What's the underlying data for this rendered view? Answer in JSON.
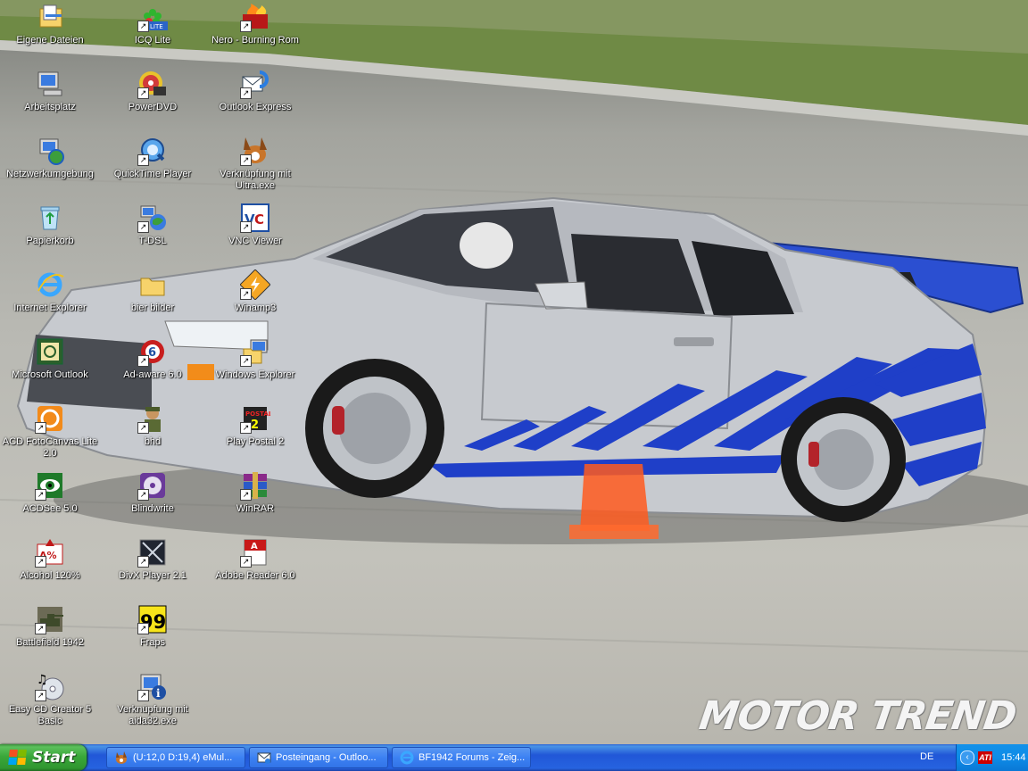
{
  "desktop": {
    "watermark": "MOTOR TREND",
    "icons": [
      {
        "label": "Eigene Dateien",
        "icon": "my-documents-icon"
      },
      {
        "label": "ICQ Lite",
        "icon": "icq-flower-icon"
      },
      {
        "label": "Nero - Burning Rom",
        "icon": "nero-flame-icon"
      },
      {
        "label": "Arbeitsplatz",
        "icon": "my-computer-icon"
      },
      {
        "label": "PowerDVD",
        "icon": "powerdvd-disc-icon"
      },
      {
        "label": "Outlook Express",
        "icon": "outlook-express-icon"
      },
      {
        "label": "Netzwerkumgebung",
        "icon": "network-places-icon"
      },
      {
        "label": "QuickTime Player",
        "icon": "quicktime-icon"
      },
      {
        "label": "Verknüpfung mit Ultra.exe",
        "icon": "emule-mule-icon"
      },
      {
        "label": "Papierkorb",
        "icon": "recycle-bin-icon"
      },
      {
        "label": "T-DSL",
        "icon": "network-globe-icon"
      },
      {
        "label": "VNC Viewer",
        "icon": "vnc-viewer-icon"
      },
      {
        "label": "Internet Explorer",
        "icon": "internet-explorer-icon"
      },
      {
        "label": "bier bilder",
        "icon": "folder-icon"
      },
      {
        "label": "Winamp3",
        "icon": "winamp-bolt-icon"
      },
      {
        "label": "Microsoft Outlook",
        "icon": "ms-outlook-icon"
      },
      {
        "label": "Ad-aware 6.0",
        "icon": "ad-aware-icon"
      },
      {
        "label": "Windows Explorer",
        "icon": "windows-explorer-icon"
      },
      {
        "label": "ACD FotoCanvas Lite 2.0",
        "icon": "fotocanvas-icon"
      },
      {
        "label": "bhd",
        "icon": "soldier-icon"
      },
      {
        "label": "Play Postal 2",
        "icon": "postal-2-icon"
      },
      {
        "label": "ACDSee 5.0",
        "icon": "acdsee-eye-icon"
      },
      {
        "label": "Blindwrite",
        "icon": "blindwrite-icon"
      },
      {
        "label": "WinRAR",
        "icon": "winrar-books-icon"
      },
      {
        "label": "Alcohol 120%",
        "icon": "alcohol-120-icon"
      },
      {
        "label": "DivX Player 2.1",
        "icon": "divx-player-icon"
      },
      {
        "label": "Adobe Reader 6.0",
        "icon": "adobe-reader-icon"
      },
      {
        "label": "Battlefield 1942",
        "icon": "battlefield-tank-icon"
      },
      {
        "label": "Fraps",
        "icon": "fraps-99-icon"
      },
      {
        "label": "Easy CD Creator 5 Basic",
        "icon": "easy-cd-creator-icon"
      },
      {
        "label": "Verknüpfung mit aida32.exe",
        "icon": "aida32-info-icon"
      }
    ]
  },
  "taskbar": {
    "start_label": "Start",
    "tasks": [
      {
        "label": "(U:12,0 D:19,4) eMul...",
        "icon": "emule-mule-icon"
      },
      {
        "label": "Posteingang - Outloo...",
        "icon": "outlook-express-icon"
      },
      {
        "label": "BF1942 Forums - Zeig...",
        "icon": "internet-explorer-icon"
      }
    ],
    "language": "DE",
    "tray_expand": "‹",
    "ati_label": "ATI",
    "clock": "15:44"
  },
  "colors": {
    "taskbar_blue": "#2563e0",
    "start_green": "#3aa83a",
    "tray_blue": "#0e8ce8",
    "car_silver": "#c7cacf",
    "car_stripe_blue": "#1f3fc8"
  }
}
